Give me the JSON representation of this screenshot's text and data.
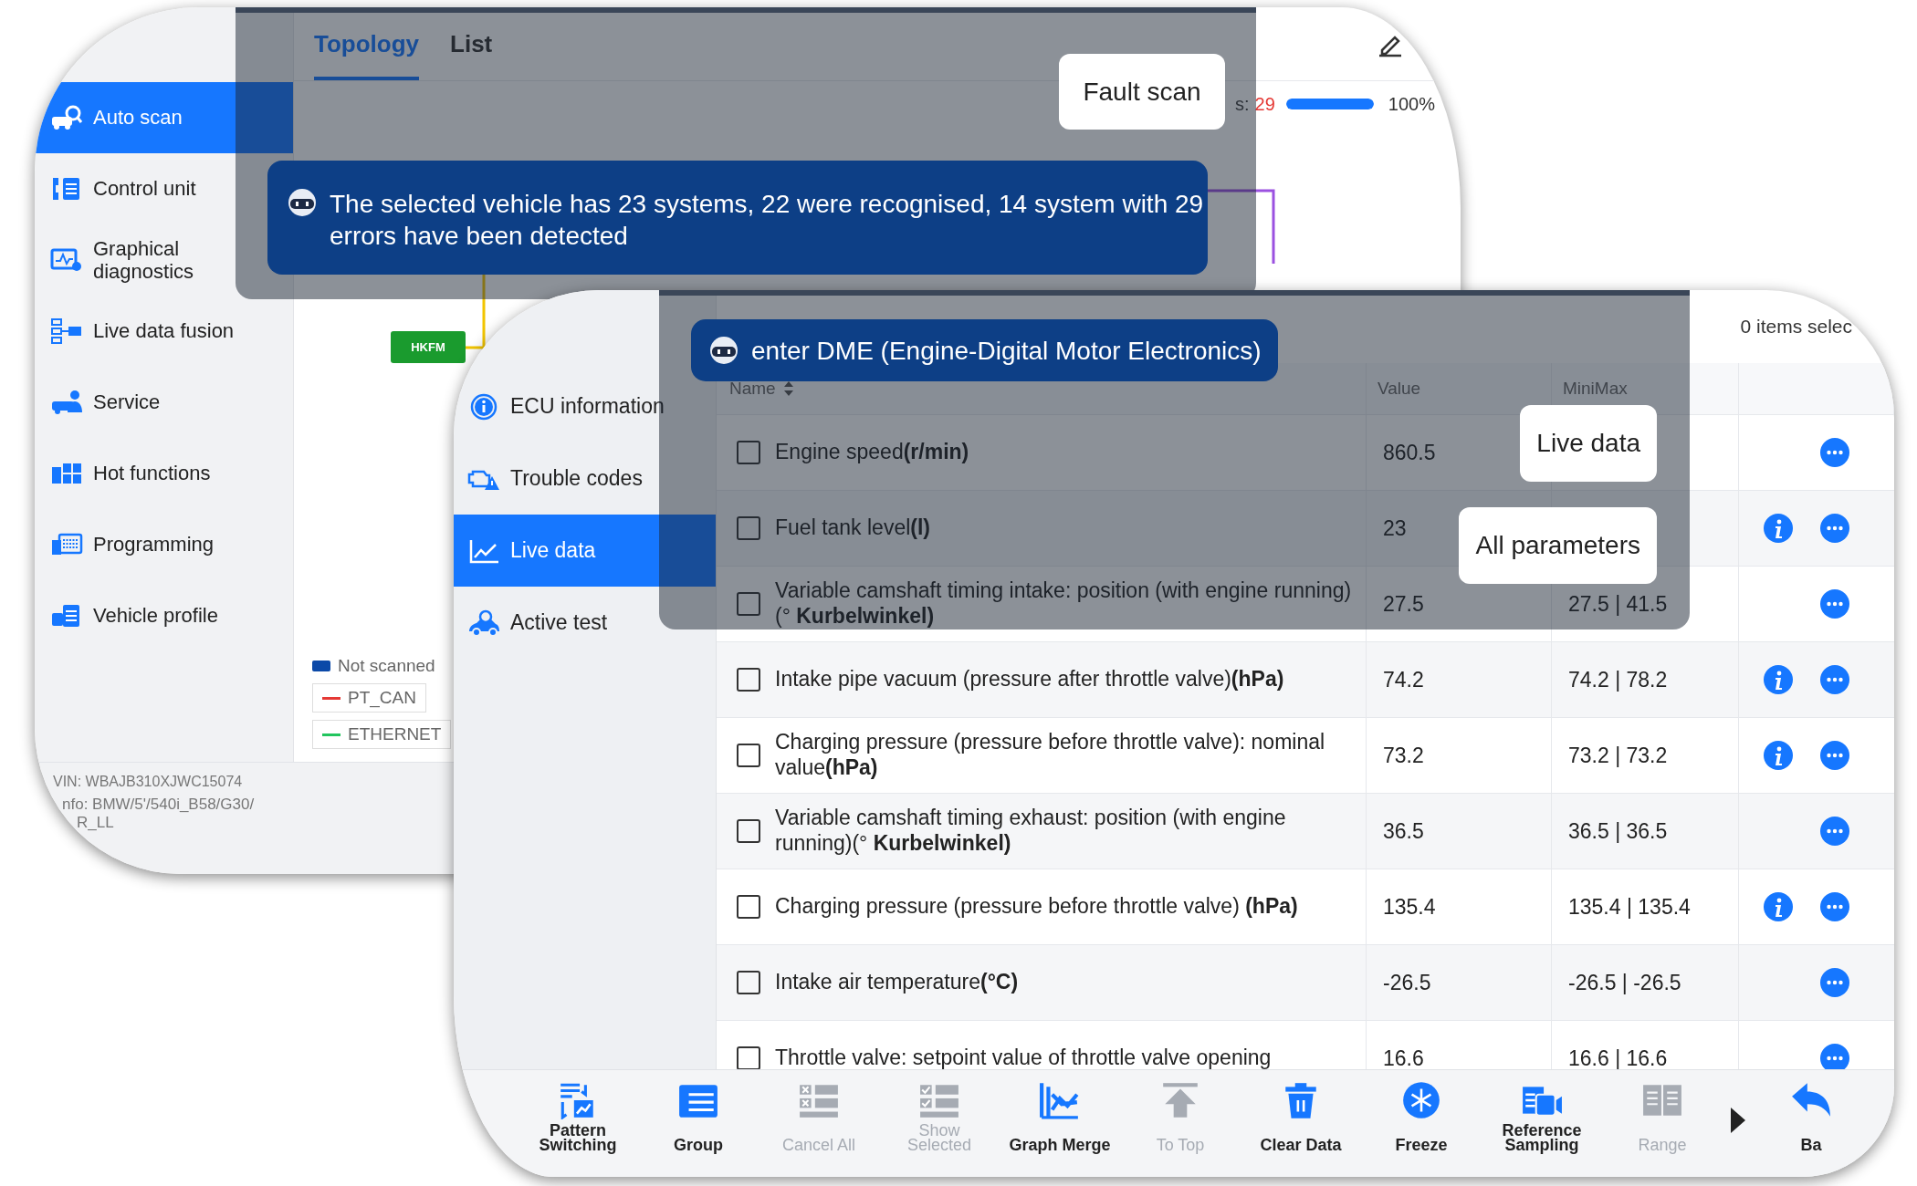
{
  "back_window": {
    "sidebar": {
      "items": [
        {
          "label": "Auto scan",
          "selected": true
        },
        {
          "label": "Control unit",
          "selected": false
        },
        {
          "label": "Graphical diagnostics",
          "selected": false
        },
        {
          "label": "Live data fusion",
          "selected": false
        },
        {
          "label": "Service",
          "selected": false
        },
        {
          "label": "Hot functions",
          "selected": false
        },
        {
          "label": "Programming",
          "selected": false
        },
        {
          "label": "Vehicle profile",
          "selected": false
        }
      ]
    },
    "tabs": [
      {
        "label": "Topology",
        "selected": true
      },
      {
        "label": "List",
        "selected": false
      }
    ],
    "progress": {
      "label": "s:",
      "count": "29",
      "level": 1,
      "reading": "100%"
    },
    "diagram": {
      "nodes": [
        {
          "label": "HKFM"
        }
      ]
    },
    "legend": {
      "not_scanned": "Not scanned",
      "buses": [
        {
          "label": "PT_CAN",
          "color": "#e53935"
        },
        {
          "label": "ETHERNET",
          "color": "#22c55e"
        }
      ]
    },
    "vehicle_info": {
      "vin": "VIN: WBAJB310XJWC15074",
      "info_lines": [
        "nfo: BMW/5'/540i_B58/G30/",
        "R_LL"
      ]
    },
    "guide": {
      "callout": "Fault scan",
      "message": "The selected vehicle has 23 systems, 22 were recognised, 14 system with 29 errors have been detected"
    }
  },
  "front_window": {
    "sidebar": {
      "items": [
        {
          "label": "ECU information",
          "selected": false
        },
        {
          "label": "Trouble codes",
          "selected": false
        },
        {
          "label": "Live data",
          "selected": true
        },
        {
          "label": "Active test",
          "selected": false
        }
      ]
    },
    "selection_count": "0 items selec",
    "table": {
      "columns": [
        "Name",
        "Value",
        "MiniMax"
      ],
      "rows": [
        {
          "checked": false,
          "name": "Engine speed**(r/min)**",
          "value": "860.5",
          "info": false
        },
        {
          "checked": false,
          "name": "Fuel tank level**(l)**",
          "value": "23",
          "info": true
        },
        {
          "checked": false,
          "name": "Variable camshaft timing intake: position (with engine running)(° **Kurbelwinkel)**",
          "value": "27.5",
          "minmax": "27.5 | 41.5",
          "info": false
        },
        {
          "checked": false,
          "name": "Intake pipe vacuum (pressure after throttle valve)**(hPa)**",
          "value": "74.2",
          "minmax": "74.2 | 78.2",
          "info": true
        },
        {
          "checked": false,
          "name": "Charging pressure (pressure before throttle valve): nominal value**(hPa)**",
          "value": "73.2",
          "minmax": "73.2 | 73.2",
          "info": true
        },
        {
          "checked": false,
          "name": "Variable camshaft timing exhaust: position (with engine running)(° **Kurbelwinkel)**",
          "value": "36.5",
          "minmax": "36.5 | 36.5",
          "info": false
        },
        {
          "checked": false,
          "name": "Charging pressure (pressure before throttle valve) **(hPa)**",
          "value": "135.4",
          "minmax": "135.4 | 135.4",
          "info": true
        },
        {
          "checked": false,
          "name": "Intake air temperature**(°C)**",
          "value": "-26.5",
          "minmax": "-26.5 | -26.5",
          "info": false
        },
        {
          "checked": false,
          "name": "Throttle valve: setpoint value of throttle valve opening",
          "value": "16.6",
          "minmax": "16.6 | 16.6",
          "info": false
        }
      ]
    },
    "toolbar": [
      {
        "label": "Pattern Switching",
        "disabled": false
      },
      {
        "label": "Group",
        "disabled": false
      },
      {
        "label": "Cancel All",
        "disabled": true
      },
      {
        "label": "Show Selected",
        "disabled": true
      },
      {
        "label": "Graph Merge",
        "disabled": false
      },
      {
        "label": "To Top",
        "disabled": true
      },
      {
        "label": "Clear Data",
        "disabled": false
      },
      {
        "label": "Freeze",
        "disabled": false
      },
      {
        "label": "Reference Sampling",
        "disabled": false
      },
      {
        "label": "Range",
        "disabled": true
      },
      {
        "label": "Ba",
        "disabled": false
      }
    ],
    "guide": {
      "message": "enter DME (Engine-Digital Motor Electronics)",
      "callouts": [
        "Live data",
        "All parameters"
      ]
    }
  }
}
